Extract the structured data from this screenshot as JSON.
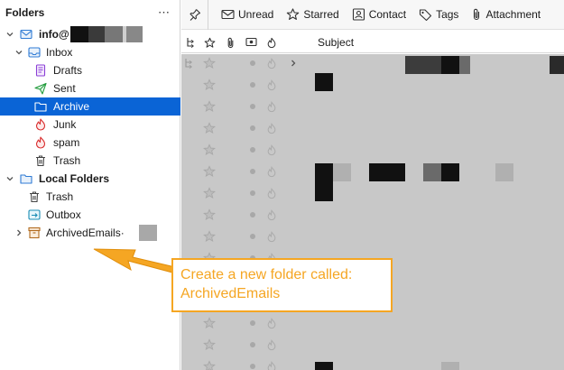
{
  "folder_pane": {
    "title": "Folders",
    "menu_glyph": "⋯",
    "account_label": "info@",
    "folders": [
      {
        "label": "Inbox",
        "icon": "inbox-icon"
      },
      {
        "label": "Drafts",
        "icon": "drafts-icon"
      },
      {
        "label": "Sent",
        "icon": "sent-icon"
      },
      {
        "label": "Archive",
        "icon": "archive-folder-icon",
        "selected": true
      },
      {
        "label": "Junk",
        "icon": "junk-icon"
      },
      {
        "label": "spam",
        "icon": "spam-icon"
      },
      {
        "label": "Trash",
        "icon": "trash-icon"
      }
    ],
    "local_label": "Local Folders",
    "local_folders": [
      {
        "label": "Trash",
        "icon": "trash-icon"
      },
      {
        "label": "Outbox",
        "icon": "outbox-icon"
      },
      {
        "label": "ArchivedEmails·",
        "icon": "archive-box-icon"
      }
    ]
  },
  "toolbar": {
    "unread": "Unread",
    "starred": "Starred",
    "contact": "Contact",
    "tags": "Tags",
    "attachment": "Attachment"
  },
  "columns": {
    "subject": "Subject"
  },
  "callout": {
    "line1": "Create a new folder called:",
    "line2": "ArchivedEmails"
  },
  "colors": {
    "selection": "#0a64d6",
    "accent": "#f5a623",
    "list_background": "#c8c8c8"
  }
}
